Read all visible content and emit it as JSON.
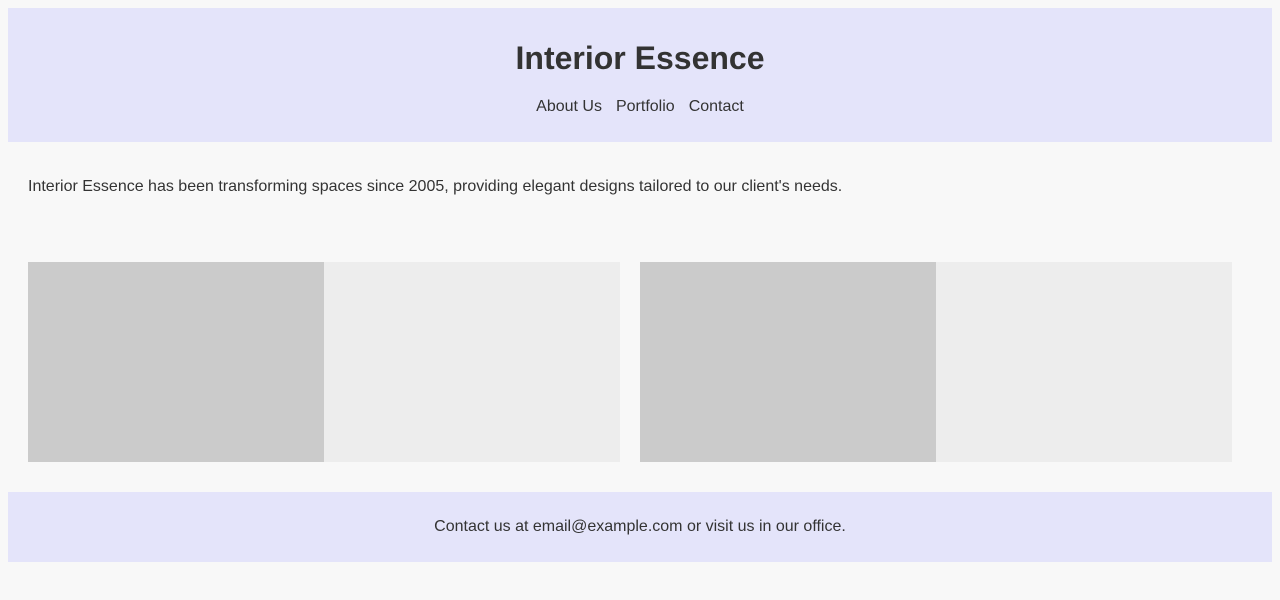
{
  "header": {
    "title": "Interior Essence",
    "nav": [
      {
        "label": "About Us"
      },
      {
        "label": "Portfolio"
      },
      {
        "label": "Contact"
      }
    ]
  },
  "intro": {
    "text": "Interior Essence has been transforming spaces since 2005, providing elegant designs tailored to our client's needs."
  },
  "gallery": {
    "items": [
      {
        "image": "placeholder-image"
      },
      {
        "image": "placeholder-image"
      }
    ]
  },
  "footer": {
    "text": "Contact us at email@example.com or visit us in our office."
  },
  "colors": {
    "background": "#f8f8f8",
    "header_bg": "#e4e4fa",
    "text": "#333333",
    "card_bg": "#ededed",
    "image_placeholder": "#cbcbcb"
  }
}
